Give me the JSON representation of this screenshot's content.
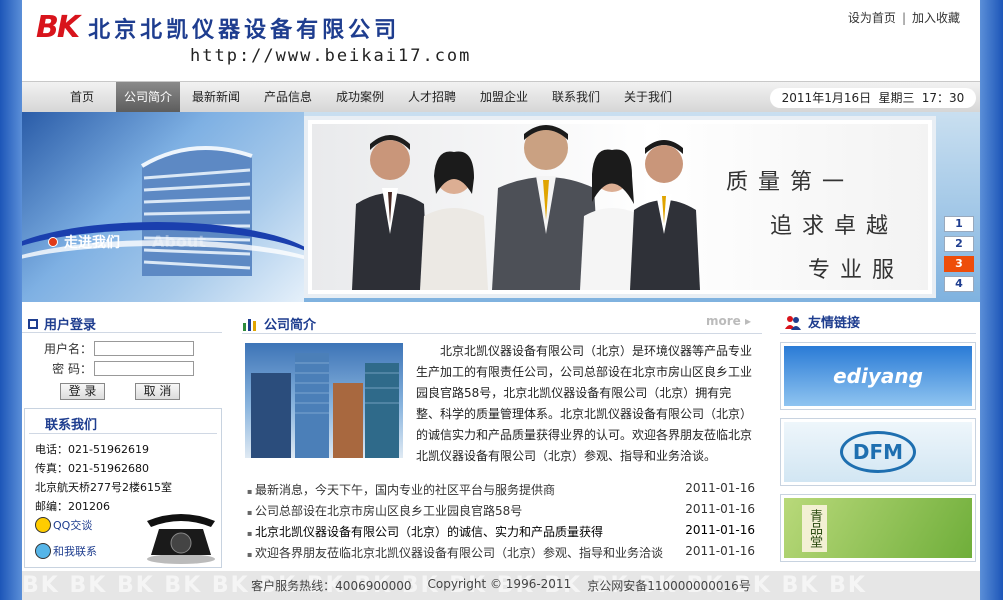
{
  "header": {
    "logo_mark": "BK",
    "company_name": "北京北凯仪器设备有限公司",
    "url": "http://www.beikai17.com",
    "set_home": "设为首页",
    "separator": "|",
    "add_favorite": "加入收藏"
  },
  "nav": {
    "items": [
      {
        "label": "首页"
      },
      {
        "label": "公司简介"
      },
      {
        "label": "最新新闻"
      },
      {
        "label": "产品信息"
      },
      {
        "label": "成功案例"
      },
      {
        "label": "人才招聘"
      },
      {
        "label": "加盟企业"
      },
      {
        "label": "联系我们"
      },
      {
        "label": "关于我们"
      }
    ],
    "active_index": 1,
    "date": "2011年1月16日",
    "weekday": "星期三",
    "time": "17：30"
  },
  "banner": {
    "walk_in": "走进我们",
    "about_watermark": "About",
    "slogan_1": "质量第一",
    "slogan_2": "追求卓越",
    "slogan_3": "专业服务",
    "pages": [
      "1",
      "2",
      "3",
      "4"
    ],
    "active_page": 2
  },
  "login": {
    "title": "用户登录",
    "username_label": "用户名：",
    "password_label": "密  码：",
    "username_value": "",
    "password_value": "",
    "login_button": "登 录",
    "cancel_button": "取 消"
  },
  "contact": {
    "title": "联系我们",
    "phone": "电话：021-51962619",
    "fax": "传真：021-51962680",
    "address": "北京航天桥277号2楼615室",
    "postcode": "邮编：201206",
    "qq_label": "QQ交谈",
    "ww_label": "和我联系"
  },
  "intro": {
    "title": "公司简介",
    "more": "more ▸",
    "text": "北京北凯仪器设备有限公司（北京）是环境仪器等产品专业生产加工的有限责任公司，公司总部设在北京市房山区良乡工业园良官路58号，北京北凯仪器设备有限公司（北京）拥有完整、科学的质量管理体系。北京北凯仪器设备有限公司（北京）的诚信实力和产品质量获得业界的认可。欢迎各界朋友莅临北京北凯仪器设备有限公司（北京）参观、指导和业务洽谈。"
  },
  "news": [
    {
      "title": "最新消息，今天下午，国内专业的社区平台与服务提供商",
      "date": "2011-01-16"
    },
    {
      "title": "公司总部设在北京市房山区良乡工业园良官路58号",
      "date": "2011-01-16"
    },
    {
      "title": "北京北凯仪器设备有限公司（北京）的诚信、实力和产品质量获得",
      "date": "2011-01-16"
    },
    {
      "title": "欢迎各界朋友莅临北京北凯仪器设备有限公司（北京）参观、指导和业务洽谈",
      "date": "2011-01-16"
    }
  ],
  "friend_links": {
    "title": "友情链接",
    "items": [
      {
        "label": "ediyang"
      },
      {
        "label": "DFM"
      },
      {
        "label": "青品堂"
      }
    ]
  },
  "footer": {
    "hotline": "客户服务热线：4006900000",
    "copyright": "Copyright © 1996-2011",
    "icp": "京公网安备110000000016号",
    "watermark": "BK BK BK BK BK BK BK BK BK BK BK BK BK BK BK BK BK BK"
  },
  "colors": {
    "brand_blue": "#1e3d8f",
    "logo_red": "#d8141c",
    "active_page": "#ee4d0a",
    "nav_active": "#6a6a6a"
  }
}
